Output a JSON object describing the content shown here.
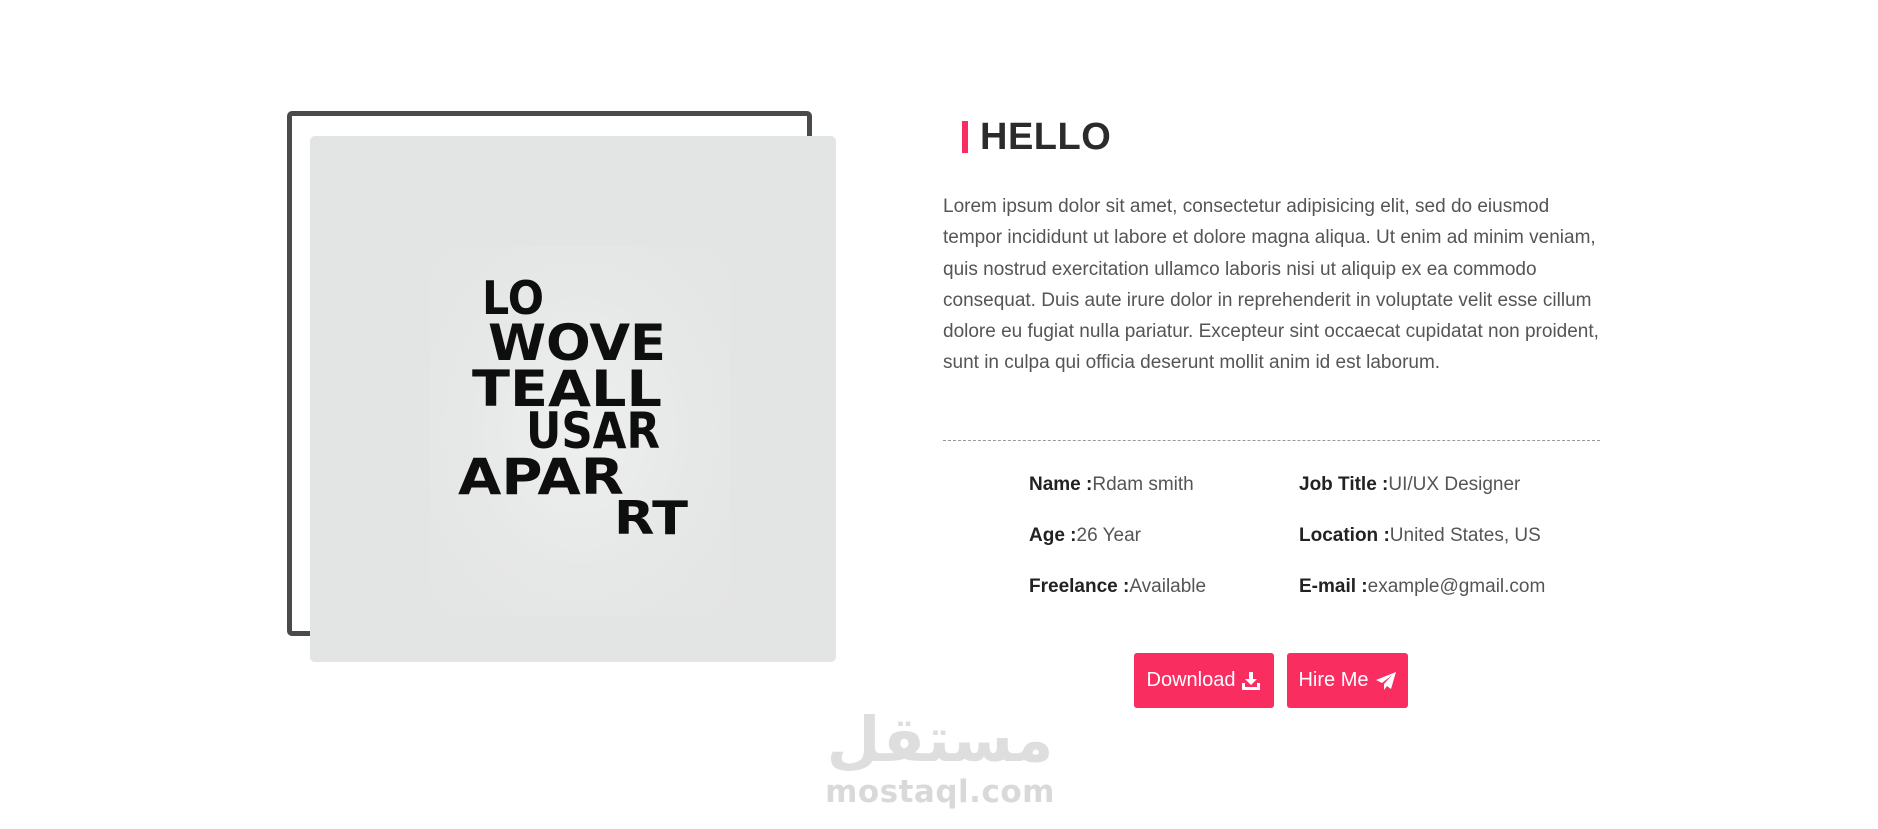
{
  "about": {
    "title": "HELLO",
    "bio": "Lorem ipsum dolor sit amet, consectetur adipisicing elit, sed do eiusmod tempor incididunt ut labore et dolore magna aliqua. Ut enim ad minim veniam, quis nostrud exercitation ullamco laboris nisi ut aliquip ex ea commodo consequat. Duis aute irure dolor in reprehenderit in voluptate velit esse cillum dolore eu fugiat nulla pariatur. Excepteur sint occaecat cupidatat non proident, sunt in culpa qui officia deserunt mollit anim id est laborum.",
    "accent_color": "#fa2d61"
  },
  "poster": {
    "lines": [
      "LO",
      "WOVE",
      "TEALL",
      "USAR",
      "APAR",
      "RT"
    ]
  },
  "info": {
    "name": {
      "label": "Name :",
      "value": "Rdam smith"
    },
    "job_title": {
      "label": "Job Title :",
      "value": "UI/UX Designer"
    },
    "age": {
      "label": "Age :",
      "value": "26 Year"
    },
    "location": {
      "label": "Location :",
      "value": "United States, US"
    },
    "freelance": {
      "label": "Freelance :",
      "value": "Available"
    },
    "email": {
      "label": "E-mail :",
      "value": "example@gmail.com"
    }
  },
  "buttons": {
    "download_label": "Download",
    "download_icon": "download-icon",
    "hire_label": "Hire Me",
    "hire_icon": "paper-plane-icon"
  },
  "watermark": {
    "arabic": "مستقل",
    "latin": "mostaql.com"
  }
}
